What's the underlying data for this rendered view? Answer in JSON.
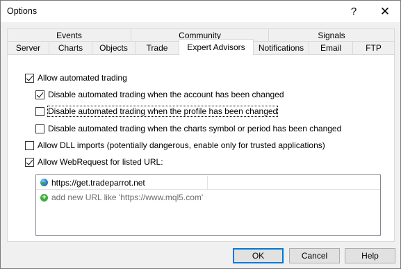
{
  "window": {
    "title": "Options",
    "help_glyph": "?",
    "close_glyph": "✕"
  },
  "tabs": {
    "row1": [
      "Events",
      "Community",
      "Signals"
    ],
    "row2": [
      "Server",
      "Charts",
      "Objects",
      "Trade",
      "Expert Advisors",
      "Notifications",
      "Email",
      "FTP"
    ],
    "active": "Expert Advisors"
  },
  "options": {
    "allow_automated": {
      "label": "Allow automated trading",
      "checked": true
    },
    "disable_account": {
      "label": "Disable automated trading when the account has been changed",
      "checked": true
    },
    "disable_profile": {
      "label": "Disable automated trading when the profile has been changed",
      "checked": false
    },
    "disable_symbol": {
      "label": "Disable automated trading when the charts symbol or period has been changed",
      "checked": false
    },
    "allow_dll": {
      "label": "Allow DLL imports (potentially dangerous, enable only for trusted applications)",
      "checked": false
    },
    "allow_webrequest": {
      "label": "Allow WebRequest for listed URL:",
      "checked": true
    }
  },
  "url_list": {
    "items": [
      "https://get.tradeparrot.net"
    ],
    "add_placeholder": "add new URL like 'https://www.mql5.com'"
  },
  "buttons": {
    "ok": "OK",
    "cancel": "Cancel",
    "help": "Help"
  }
}
